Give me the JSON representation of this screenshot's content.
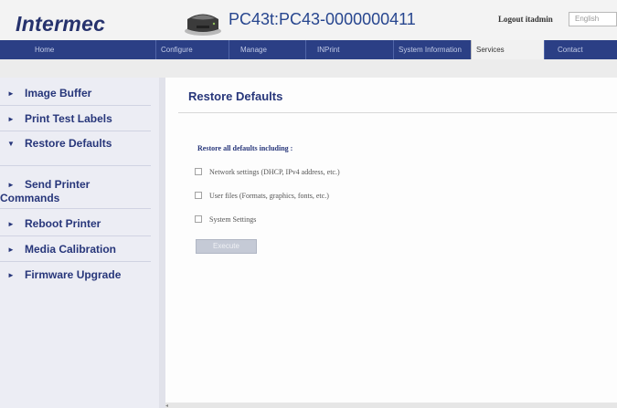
{
  "header": {
    "logo": "Intermec",
    "printer_name": "PC43t:PC43-0000000411",
    "logout": "Logout itadmin",
    "language": "English"
  },
  "nav": {
    "items": [
      {
        "label": "Home"
      },
      {
        "label": "Configure"
      },
      {
        "label": "Manage"
      },
      {
        "label": "INPrint"
      },
      {
        "label": "System Information"
      },
      {
        "label": "Services"
      },
      {
        "label": "Contact"
      }
    ],
    "active": "Services"
  },
  "sidebar": {
    "items": [
      {
        "label": "Image Buffer",
        "arrow": "►"
      },
      {
        "label": "Print Test Labels",
        "arrow": "►"
      },
      {
        "label": "Restore Defaults",
        "arrow": "▼"
      },
      {
        "label_line1": "Send Printer",
        "label_line2": "Commands",
        "arrow": "►"
      },
      {
        "label": "Reboot Printer",
        "arrow": "►"
      },
      {
        "label": "Media Calibration",
        "arrow": "►"
      },
      {
        "label": "Firmware Upgrade",
        "arrow": "►"
      }
    ]
  },
  "main": {
    "title": "Restore Defaults",
    "section_heading": "Restore all defaults including :",
    "options": [
      {
        "label": "Network settings (DHCP, IPv4 address, etc.)",
        "checked": false
      },
      {
        "label": "User files (Formats, graphics, fonts, etc.)",
        "checked": false
      },
      {
        "label": "System Settings",
        "checked": false
      }
    ],
    "execute_label": "Execute"
  },
  "colors": {
    "navbar": "#2b3f85",
    "accent_text": "#27367a",
    "sidebar_bg": "#ecedf4"
  }
}
